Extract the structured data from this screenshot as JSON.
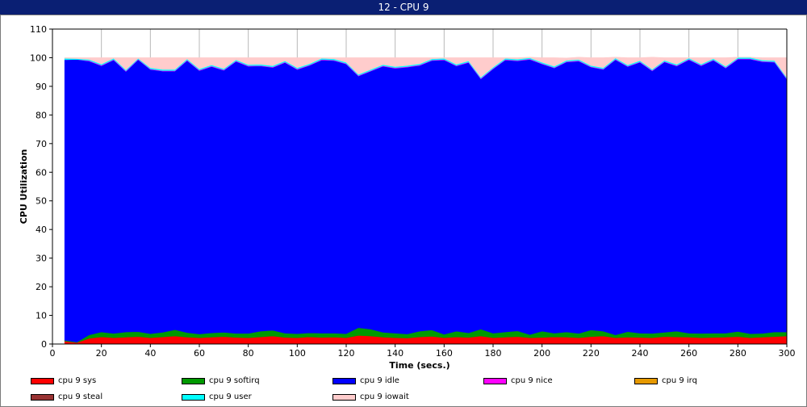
{
  "window": {
    "title": "12 - CPU 9"
  },
  "chart_data": {
    "type": "area",
    "stacked": true,
    "title": "",
    "xlabel": "Time (secs.)",
    "ylabel": "CPU Utilization",
    "xlim": [
      0,
      300
    ],
    "ylim": [
      0,
      110
    ],
    "xticks": [
      0,
      20,
      40,
      60,
      80,
      100,
      120,
      140,
      160,
      180,
      200,
      220,
      240,
      260,
      280,
      300
    ],
    "yticks": [
      0,
      10,
      20,
      30,
      40,
      50,
      60,
      70,
      80,
      90,
      100,
      110
    ],
    "grid": "vertical",
    "legend_position": "bottom",
    "x": [
      5,
      10,
      15,
      20,
      25,
      30,
      35,
      40,
      45,
      50,
      55,
      60,
      65,
      70,
      75,
      80,
      85,
      90,
      95,
      100,
      105,
      110,
      115,
      120,
      125,
      130,
      135,
      140,
      145,
      150,
      155,
      160,
      165,
      170,
      175,
      180,
      185,
      190,
      195,
      200,
      205,
      210,
      215,
      220,
      225,
      230,
      235,
      240,
      245,
      250,
      255,
      260,
      265,
      270,
      275,
      280,
      285,
      290,
      295,
      300
    ],
    "series": [
      {
        "name": "cpu 9 sys",
        "color": "#ff0000",
        "values": [
          1.0,
          0.5,
          2.0,
          2.5,
          2.2,
          2.4,
          2.6,
          2.2,
          2.5,
          2.8,
          2.4,
          2.2,
          2.4,
          2.6,
          2.3,
          2.2,
          2.5,
          2.8,
          2.3,
          2.2,
          2.5,
          2.3,
          2.4,
          2.2,
          3.0,
          2.8,
          2.4,
          2.2,
          2.1,
          2.5,
          2.7,
          2.2,
          2.5,
          2.3,
          2.8,
          2.2,
          2.4,
          2.6,
          2.2,
          2.3,
          2.5,
          2.4,
          2.2,
          2.6,
          2.8,
          2.2,
          2.4,
          2.3,
          2.2,
          2.6,
          2.5,
          2.4,
          2.2,
          2.3,
          2.4,
          2.6,
          2.2,
          2.4,
          2.6,
          2.8
        ]
      },
      {
        "name": "cpu 9 softirq",
        "color": "#009900",
        "values": [
          0.3,
          0.2,
          1.2,
          1.7,
          1.5,
          1.8,
          1.7,
          1.4,
          1.6,
          2.2,
          1.6,
          1.3,
          1.5,
          1.5,
          1.4,
          1.5,
          2.0,
          2.0,
          1.5,
          1.4,
          1.4,
          1.5,
          1.4,
          1.4,
          2.7,
          2.4,
          1.7,
          1.6,
          1.4,
          2.0,
          2.2,
          1.2,
          2.0,
          1.6,
          2.4,
          1.6,
          1.8,
          2.0,
          1.1,
          2.2,
          1.3,
          1.8,
          1.5,
          2.3,
          1.7,
          1.0,
          1.9,
          1.5,
          1.5,
          1.5,
          2.0,
          1.4,
          1.5,
          1.5,
          1.4,
          1.8,
          1.4,
          1.3,
          1.6,
          1.4
        ]
      },
      {
        "name": "cpu 9 idle",
        "color": "#0000ff",
        "values": [
          98.0,
          98.7,
          95.6,
          93.0,
          95.5,
          91.0,
          95.0,
          92.3,
          91.2,
          90.3,
          95.0,
          92.0,
          93.0,
          91.5,
          95.0,
          93.3,
          92.6,
          91.8,
          94.5,
          92.3,
          93.4,
          95.4,
          95.2,
          94.2,
          87.9,
          90.1,
          92.9,
          92.5,
          93.2,
          92.8,
          94.1,
          95.8,
          92.6,
          94.4,
          87.4,
          92.3,
          95.0,
          94.3,
          96.1,
          93.3,
          92.6,
          94.3,
          95.1,
          91.8,
          91.4,
          96.1,
          92.6,
          94.6,
          91.7,
          94.4,
          92.6,
          95.5,
          93.5,
          95.3,
          92.6,
          95.1,
          95.9,
          94.9,
          94.2,
          88.3
        ]
      },
      {
        "name": "cpu 9 nice",
        "color": "#ff00ff",
        "values": [
          0,
          0,
          0.2,
          0.2,
          0.2,
          0.2,
          0.2,
          0.2,
          0.2,
          0.2,
          0.2,
          0.2,
          0.2,
          0.2,
          0.2,
          0.2,
          0.2,
          0.2,
          0.2,
          0.2,
          0.2,
          0.2,
          0.2,
          0.2,
          0.2,
          0.2,
          0.2,
          0.2,
          0.2,
          0.2,
          0.2,
          0.2,
          0.2,
          0.2,
          0.2,
          0.2,
          0.2,
          0.2,
          0.2,
          0.2,
          0.2,
          0.2,
          0.2,
          0.2,
          0.2,
          0.2,
          0.2,
          0.2,
          0.2,
          0.2,
          0.2,
          0.2,
          0.2,
          0.2,
          0.2,
          0.2,
          0.2,
          0.2,
          0.2,
          0.2
        ]
      },
      {
        "name": "cpu 9 irq",
        "color": "#e69900",
        "values": []
      },
      {
        "name": "cpu 9 steal",
        "color": "#993333",
        "values": []
      },
      {
        "name": "cpu 9 user",
        "color": "#00ffff",
        "values": [
          0.5,
          0.3,
          0.4,
          0.4,
          0.4,
          0.4,
          0.3,
          0.4,
          0.4,
          0.4,
          0.4,
          0.4,
          0.4,
          0.4,
          0.4,
          0.4,
          0.4,
          0.4,
          0.4,
          0.4,
          0.4,
          0.4,
          0.4,
          0.4,
          0.4,
          0.4,
          0.4,
          0.4,
          0.4,
          0.4,
          0.4,
          0.4,
          0.4,
          0.4,
          0.4,
          0.4,
          0.4,
          0.4,
          0.4,
          0.4,
          0.4,
          0.4,
          0.4,
          0.4,
          0.4,
          0.4,
          0.4,
          0.4,
          0.4,
          0.4,
          0.4,
          0.4,
          0.4,
          0.4,
          0.4,
          0.4,
          0.4,
          0.4,
          0.4,
          0.4
        ]
      },
      {
        "name": "cpu 9 iowait",
        "color": "#ffcccc",
        "values": [
          0.2,
          0.3,
          0.6,
          2.2,
          0.2,
          4.2,
          0.2,
          3.5,
          4.1,
          4.1,
          0.4,
          3.9,
          2.5,
          3.8,
          0.7,
          2.4,
          2.3,
          2.8,
          1.1,
          3.5,
          2.1,
          0.2,
          0.4,
          1.6,
          5.8,
          4.1,
          2.4,
          3.1,
          2.7,
          2.1,
          0.4,
          0.2,
          2.3,
          1.1,
          6.8,
          3.3,
          0.2,
          0.5,
          0.2,
          1.6,
          3.0,
          0.8,
          0.8,
          2.7,
          3.5,
          0.3,
          2.5,
          1.0,
          4.2,
          0.9,
          2.3,
          0.1,
          2.2,
          0.3,
          3.0,
          0.1,
          0.1,
          0.8,
          1.0,
          6.9
        ]
      }
    ]
  }
}
